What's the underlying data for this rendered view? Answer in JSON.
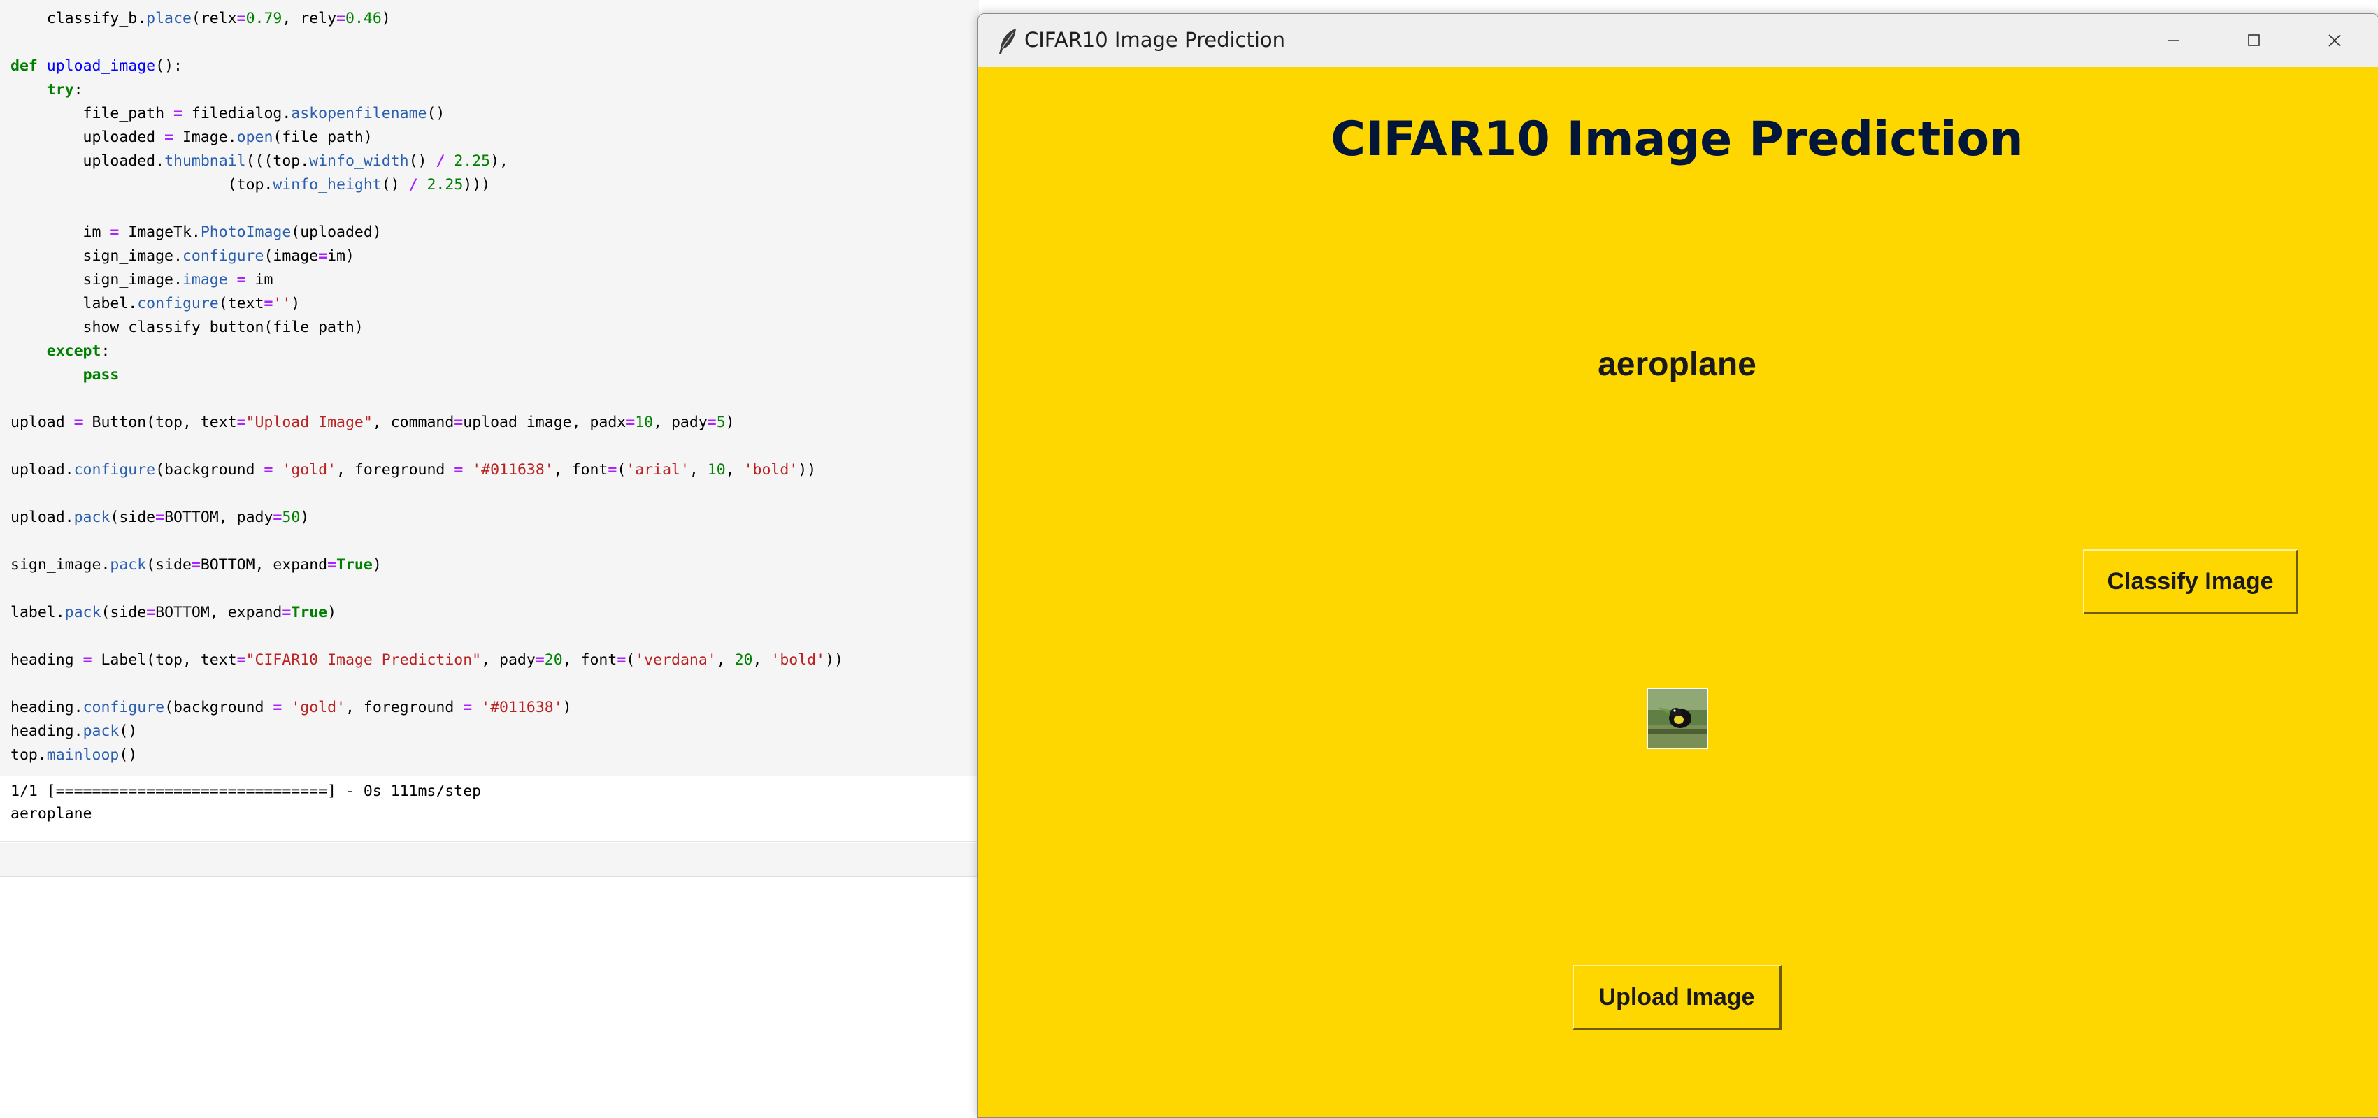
{
  "notebook": {
    "code_lines": [
      [
        [
          "    classify_b.",
          "t"
        ],
        [
          "place",
          "at"
        ],
        [
          "(relx",
          "t"
        ],
        [
          "=",
          "op"
        ],
        [
          "0.79",
          "nu"
        ],
        [
          ", rely",
          "t"
        ],
        [
          "=",
          "op"
        ],
        [
          "0.46",
          "nu"
        ],
        [
          ")",
          "t"
        ]
      ],
      [],
      [
        [
          "def",
          "kw"
        ],
        [
          " ",
          "t"
        ],
        [
          "upload_image",
          "fn"
        ],
        [
          "():",
          "t"
        ]
      ],
      [
        [
          "    ",
          "t"
        ],
        [
          "try",
          "kw"
        ],
        [
          ":",
          "t"
        ]
      ],
      [
        [
          "        file_path ",
          "t"
        ],
        [
          "=",
          "op"
        ],
        [
          " filedialog.",
          "t"
        ],
        [
          "askopenfilename",
          "at"
        ],
        [
          "()",
          "t"
        ]
      ],
      [
        [
          "        uploaded ",
          "t"
        ],
        [
          "=",
          "op"
        ],
        [
          " Image.",
          "t"
        ],
        [
          "open",
          "at"
        ],
        [
          "(file_path)",
          "t"
        ]
      ],
      [
        [
          "        uploaded.",
          "t"
        ],
        [
          "thumbnail",
          "at"
        ],
        [
          "(((top.",
          "t"
        ],
        [
          "winfo_width",
          "at"
        ],
        [
          "() ",
          "t"
        ],
        [
          "/",
          "op"
        ],
        [
          " ",
          "t"
        ],
        [
          "2.25",
          "nu"
        ],
        [
          "),",
          "t"
        ]
      ],
      [
        [
          "                        (top.",
          "t"
        ],
        [
          "winfo_height",
          "at"
        ],
        [
          "() ",
          "t"
        ],
        [
          "/",
          "op"
        ],
        [
          " ",
          "t"
        ],
        [
          "2.25",
          "nu"
        ],
        [
          ")))",
          "t"
        ]
      ],
      [],
      [
        [
          "        im ",
          "t"
        ],
        [
          "=",
          "op"
        ],
        [
          " ImageTk.",
          "t"
        ],
        [
          "PhotoImage",
          "at"
        ],
        [
          "(uploaded)",
          "t"
        ]
      ],
      [
        [
          "        sign_image.",
          "t"
        ],
        [
          "configure",
          "at"
        ],
        [
          "(image",
          "t"
        ],
        [
          "=",
          "op"
        ],
        [
          "im)",
          "t"
        ]
      ],
      [
        [
          "        sign_image.",
          "t"
        ],
        [
          "image",
          "at"
        ],
        [
          " ",
          "t"
        ],
        [
          "=",
          "op"
        ],
        [
          " im",
          "t"
        ]
      ],
      [
        [
          "        label.",
          "t"
        ],
        [
          "configure",
          "at"
        ],
        [
          "(text",
          "t"
        ],
        [
          "=",
          "op"
        ],
        [
          "''",
          "st"
        ],
        [
          ")",
          "t"
        ]
      ],
      [
        [
          "        show_classify_button(file_path)",
          "t"
        ]
      ],
      [
        [
          "    ",
          "t"
        ],
        [
          "except",
          "kw"
        ],
        [
          ":",
          "t"
        ]
      ],
      [
        [
          "        ",
          "t"
        ],
        [
          "pass",
          "kw"
        ]
      ],
      [],
      [
        [
          "upload ",
          "t"
        ],
        [
          "=",
          "op"
        ],
        [
          " Button(top, text",
          "t"
        ],
        [
          "=",
          "op"
        ],
        [
          "\"Upload Image\"",
          "st"
        ],
        [
          ", command",
          "t"
        ],
        [
          "=",
          "op"
        ],
        [
          "upload_image, padx",
          "t"
        ],
        [
          "=",
          "op"
        ],
        [
          "10",
          "nu"
        ],
        [
          ", pady",
          "t"
        ],
        [
          "=",
          "op"
        ],
        [
          "5",
          "nu"
        ],
        [
          ")",
          "t"
        ]
      ],
      [],
      [
        [
          "upload.",
          "t"
        ],
        [
          "configure",
          "at"
        ],
        [
          "(background ",
          "t"
        ],
        [
          "=",
          "op"
        ],
        [
          " ",
          "t"
        ],
        [
          "'gold'",
          "st"
        ],
        [
          ", foreground ",
          "t"
        ],
        [
          "=",
          "op"
        ],
        [
          " ",
          "t"
        ],
        [
          "'#011638'",
          "st"
        ],
        [
          ", font",
          "t"
        ],
        [
          "=",
          "op"
        ],
        [
          "(",
          "t"
        ],
        [
          "'arial'",
          "st"
        ],
        [
          ", ",
          "t"
        ],
        [
          "10",
          "nu"
        ],
        [
          ", ",
          "t"
        ],
        [
          "'bold'",
          "st"
        ],
        [
          "))",
          "t"
        ]
      ],
      [],
      [
        [
          "upload.",
          "t"
        ],
        [
          "pack",
          "at"
        ],
        [
          "(side",
          "t"
        ],
        [
          "=",
          "op"
        ],
        [
          "BOTTOM, pady",
          "t"
        ],
        [
          "=",
          "op"
        ],
        [
          "50",
          "nu"
        ],
        [
          ")",
          "t"
        ]
      ],
      [],
      [
        [
          "sign_image.",
          "t"
        ],
        [
          "pack",
          "at"
        ],
        [
          "(side",
          "t"
        ],
        [
          "=",
          "op"
        ],
        [
          "BOTTOM, expand",
          "t"
        ],
        [
          "=",
          "op"
        ],
        [
          "True",
          "kw"
        ],
        [
          ")",
          "t"
        ]
      ],
      [],
      [
        [
          "label.",
          "t"
        ],
        [
          "pack",
          "at"
        ],
        [
          "(side",
          "t"
        ],
        [
          "=",
          "op"
        ],
        [
          "BOTTOM, expand",
          "t"
        ],
        [
          "=",
          "op"
        ],
        [
          "True",
          "kw"
        ],
        [
          ")",
          "t"
        ]
      ],
      [],
      [
        [
          "heading ",
          "t"
        ],
        [
          "=",
          "op"
        ],
        [
          " Label(top, text",
          "t"
        ],
        [
          "=",
          "op"
        ],
        [
          "\"CIFAR10 Image Prediction\"",
          "st"
        ],
        [
          ", pady",
          "t"
        ],
        [
          "=",
          "op"
        ],
        [
          "20",
          "nu"
        ],
        [
          ", font",
          "t"
        ],
        [
          "=",
          "op"
        ],
        [
          "(",
          "t"
        ],
        [
          "'verdana'",
          "st"
        ],
        [
          ", ",
          "t"
        ],
        [
          "20",
          "nu"
        ],
        [
          ", ",
          "t"
        ],
        [
          "'bold'",
          "st"
        ],
        [
          "))",
          "t"
        ]
      ],
      [],
      [
        [
          "heading.",
          "t"
        ],
        [
          "configure",
          "at"
        ],
        [
          "(background ",
          "t"
        ],
        [
          "=",
          "op"
        ],
        [
          " ",
          "t"
        ],
        [
          "'gold'",
          "st"
        ],
        [
          ", foreground ",
          "t"
        ],
        [
          "=",
          "op"
        ],
        [
          " ",
          "t"
        ],
        [
          "'#011638'",
          "st"
        ],
        [
          ")",
          "t"
        ]
      ],
      [
        [
          "heading.",
          "t"
        ],
        [
          "pack",
          "at"
        ],
        [
          "()",
          "t"
        ]
      ],
      [
        [
          "top.",
          "t"
        ],
        [
          "mainloop",
          "at"
        ],
        [
          "()",
          "t"
        ]
      ]
    ],
    "output": {
      "progress_line": "1/1 [==============================] - 0s 111ms/step",
      "result_line": "aeroplane"
    }
  },
  "tk_window": {
    "title": "CIFAR10 Image Prediction",
    "icon": "feather-icon",
    "controls": [
      "minimize-icon",
      "maximize-icon",
      "close-icon"
    ],
    "background_color": "#ffd700",
    "heading": {
      "text": "CIFAR10 Image Prediction",
      "color": "#011638"
    },
    "prediction_label": "aeroplane",
    "classify_button_label": "Classify Image",
    "upload_button_label": "Upload Image",
    "thumbnail": "bird-photo-thumbnail"
  }
}
